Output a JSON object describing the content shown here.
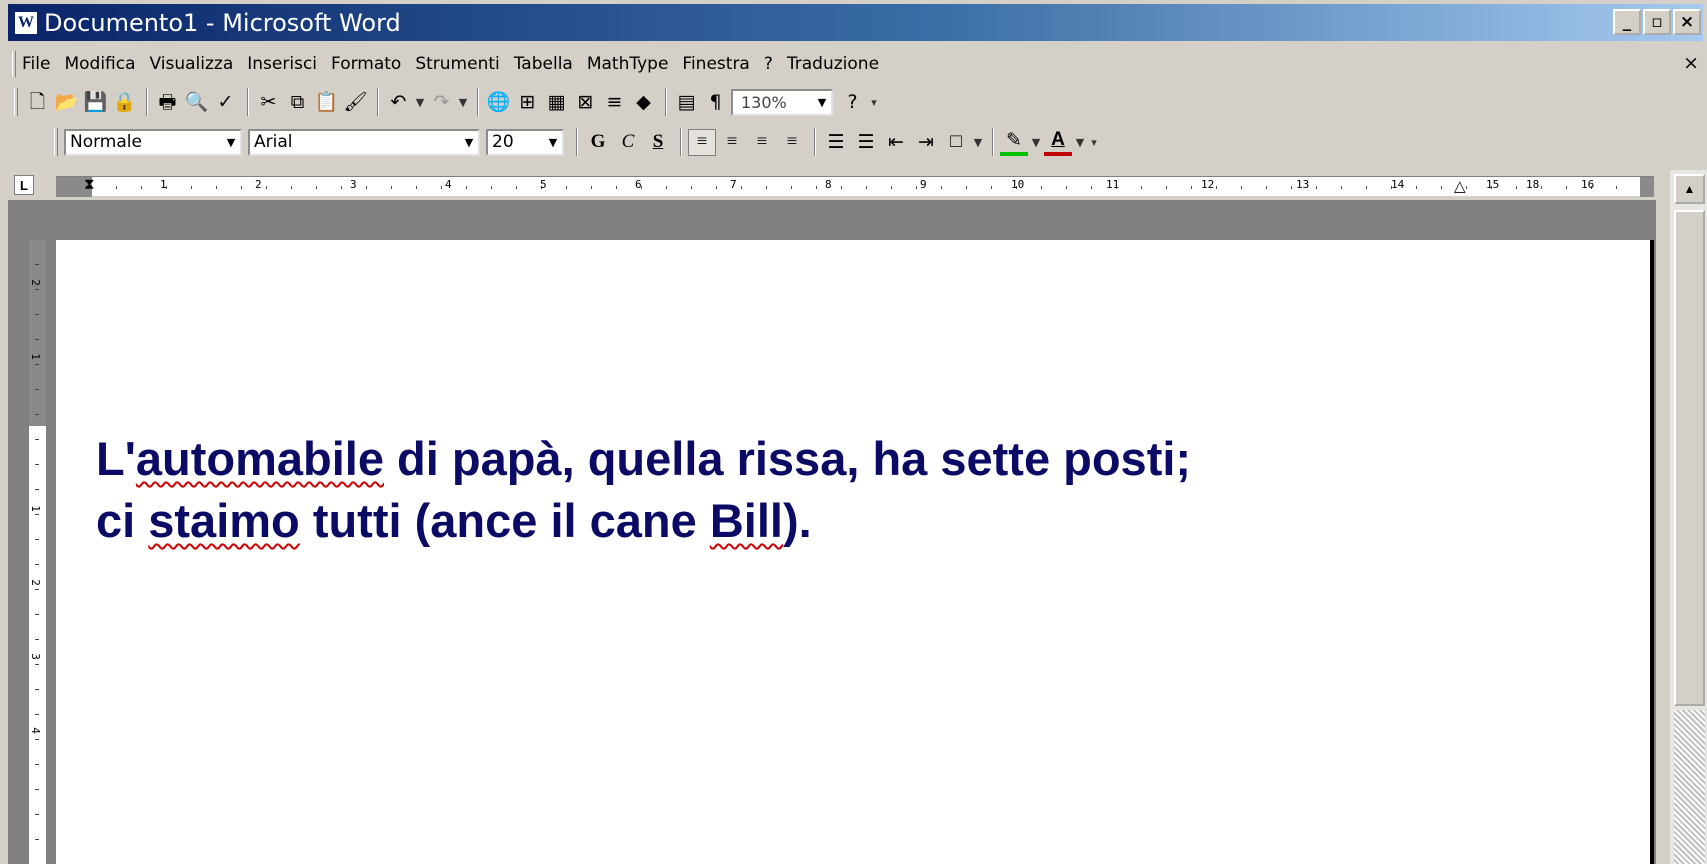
{
  "window": {
    "title": "Documento1 - Microsoft Word",
    "app_icon": "W",
    "controls": {
      "minimize": "_",
      "maximize": "▫",
      "close": "×"
    }
  },
  "menubar": {
    "items": [
      "File",
      "Modifica",
      "Visualizza",
      "Inserisci",
      "Formato",
      "Strumenti",
      "Tabella",
      "MathType",
      "Finestra",
      "?",
      "Traduzione"
    ],
    "close_label": "×"
  },
  "standard_toolbar": {
    "icons": {
      "new": "🗋",
      "open": "📂",
      "save": "💾",
      "permission": "🔒",
      "print": "🖶",
      "print_preview": "🔍",
      "spelling": "✓",
      "cut": "✂",
      "copy": "⧉",
      "paste": "📋",
      "format_painter": "🖌",
      "undo": "↶",
      "redo": "↷",
      "hyperlink": "🌐",
      "tables_borders": "⊞",
      "insert_table": "▦",
      "insert_excel": "⊠",
      "columns": "≡",
      "drawing": "◆",
      "document_map": "▤",
      "show_hide": "¶",
      "help": "?"
    },
    "zoom": "130%"
  },
  "format_toolbar": {
    "style": "Normale",
    "font": "Arial",
    "font_size": "20",
    "bold": "G",
    "italic": "C",
    "underline": "S",
    "icons": {
      "align_left": "≡",
      "center": "≡",
      "align_right": "≡",
      "justify": "≡",
      "numbering": "☰",
      "bullets": "☰",
      "decrease_indent": "⇤",
      "increase_indent": "⇥",
      "border": "□",
      "highlight": "✎",
      "font_color": "A"
    },
    "highlight_color": "#00c000",
    "font_color_bar": "#c00000"
  },
  "ruler": {
    "corner": "L",
    "labels": [
      "1",
      "2",
      "3",
      "4",
      "5",
      "6",
      "7",
      "8",
      "9",
      "10",
      "11",
      "12",
      "13",
      "14",
      "15",
      "16",
      "18"
    ],
    "vertical_labels": [
      "2",
      "1",
      "1",
      "2",
      "3",
      "4"
    ]
  },
  "document": {
    "line1_word1": "L'",
    "line1_word1_misspelled": "automabile",
    "line1_rest": " di papà, quella rissa, ha sette posti;",
    "line2_word1": "ci ",
    "line2_misspelled": "staimo",
    "line2_middle": " tutti (ance il cane ",
    "line2_name": "Bill",
    "line2_end": ").",
    "text_color": "#0b0b66",
    "squiggle_color": "#d00000"
  },
  "scrollbar": {
    "up_arrow": "▲"
  }
}
